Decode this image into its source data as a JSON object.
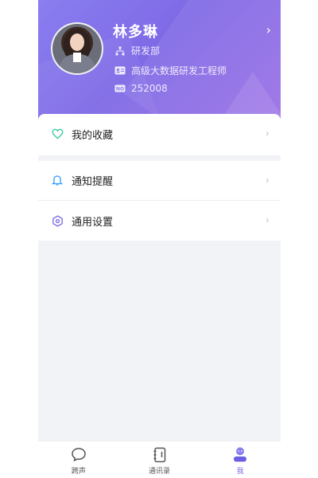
{
  "profile": {
    "name": "林多琳",
    "department": "研发部",
    "job_title": "高级大数据研发工程师",
    "employee_no": "252008",
    "chevron": "›",
    "icons": {
      "department": "org-structure-icon",
      "job_title": "id-card-icon",
      "employee_no": "number-badge-icon"
    }
  },
  "menu": {
    "favorites": {
      "label": "我的收藏",
      "icon": "heart-icon",
      "color": "#3cc9a0"
    },
    "notifications": {
      "label": "通知提醒",
      "icon": "bell-icon",
      "color": "#3aa0ff"
    },
    "settings": {
      "label": "通用设置",
      "icon": "settings-hex-icon",
      "color": "#7b6ee6"
    },
    "chevron": "›"
  },
  "tabbar": {
    "items": [
      {
        "label": "跨声",
        "icon": "chat-bubble-icon",
        "active": false
      },
      {
        "label": "通讯录",
        "icon": "contacts-book-icon",
        "active": false
      },
      {
        "label": "我",
        "icon": "user-icon",
        "active": true
      }
    ]
  },
  "colors": {
    "header_gradient_start": "#8a7ef0",
    "header_gradient_end": "#9b6fe6",
    "accent": "#7b6ee6",
    "page_background": "#f2f3f7"
  }
}
